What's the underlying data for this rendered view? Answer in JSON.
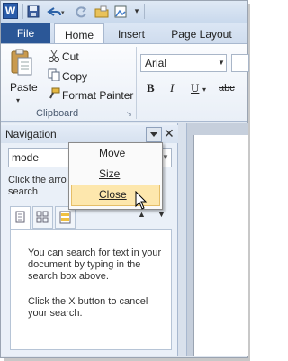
{
  "app": {
    "logo_letter": "W"
  },
  "tabs": [
    {
      "label": "File",
      "active": false
    },
    {
      "label": "Home",
      "active": true
    },
    {
      "label": "Insert",
      "active": false
    },
    {
      "label": "Page Layout",
      "active": false
    }
  ],
  "clipboard": {
    "paste_label": "Paste",
    "cut_label": "Cut",
    "copy_label": "Copy",
    "format_painter_label": "Format Painter",
    "group_label": "Clipboard"
  },
  "font": {
    "family_value": "Arial",
    "bold": "B",
    "italic": "I",
    "underline": "U",
    "strikethrough": "abc"
  },
  "navigation": {
    "title": "Navigation",
    "close_glyph": "✕",
    "search_value": "mode",
    "hint_line1": "Click the arro",
    "hint_line2": "search",
    "results_para1": "You can search for text in your document by typing in the search box above.",
    "results_para2": "Click the X button to cancel your search."
  },
  "menu": {
    "items": [
      "Move",
      "Size",
      "Close"
    ],
    "highlighted": "Close"
  },
  "colors": {
    "file_tab": "#2b5797",
    "menu_highlight": "#fde7ad"
  }
}
